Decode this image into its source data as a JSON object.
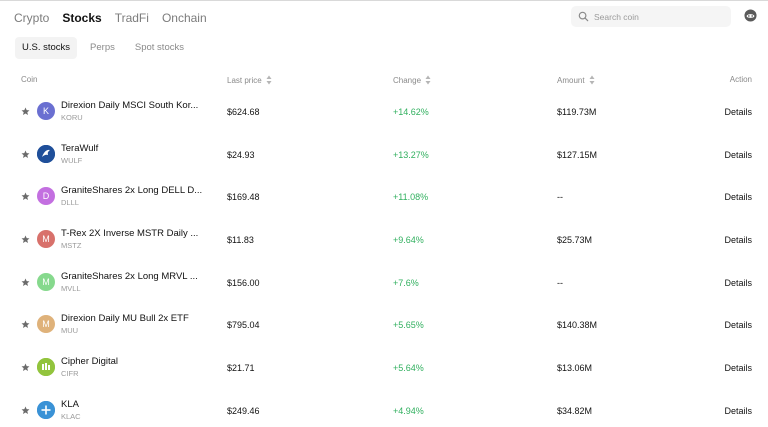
{
  "tabs": [
    {
      "label": "Crypto",
      "active": false
    },
    {
      "label": "Stocks",
      "active": true
    },
    {
      "label": "TradFi",
      "active": false
    },
    {
      "label": "Onchain",
      "active": false
    }
  ],
  "search": {
    "placeholder": "Search coin",
    "icon": "search-icon"
  },
  "profile": {
    "icon": "user-avatar-icon"
  },
  "subtabs": [
    {
      "label": "U.S. stocks",
      "active": true
    },
    {
      "label": "Perps",
      "active": false
    },
    {
      "label": "Spot stocks",
      "active": false
    }
  ],
  "table": {
    "headers": {
      "coin": "Coin",
      "last_price": "Last price",
      "change": "Change",
      "amount": "Amount",
      "action": "Action"
    },
    "rows": [
      {
        "name": "Direxion Daily MSCI South Kor...",
        "ticker": "KORU",
        "avatar_letter": "K",
        "avatar_color": "#6a6fd1",
        "price": "$624.68",
        "change": "+14.62%",
        "amount": "$119.73M",
        "action": "Details"
      },
      {
        "name": "TeraWulf",
        "ticker": "WULF",
        "avatar_letter": "",
        "avatar_color": "#1f4f9a",
        "price": "$24.93",
        "change": "+13.27%",
        "amount": "$127.15M",
        "action": "Details"
      },
      {
        "name": "GraniteShares 2x Long DELL D...",
        "ticker": "DLLL",
        "avatar_letter": "D",
        "avatar_color": "#c36fe0",
        "price": "$169.48",
        "change": "+11.08%",
        "amount": "--",
        "action": "Details"
      },
      {
        "name": "T-Rex 2X Inverse MSTR Daily ...",
        "ticker": "MSTZ",
        "avatar_letter": "M",
        "avatar_color": "#d8716b",
        "price": "$11.83",
        "change": "+9.64%",
        "amount": "$25.73M",
        "action": "Details"
      },
      {
        "name": "GraniteShares 2x Long MRVL ...",
        "ticker": "MVLL",
        "avatar_letter": "M",
        "avatar_color": "#86d98d",
        "price": "$156.00",
        "change": "+7.6%",
        "amount": "--",
        "action": "Details"
      },
      {
        "name": "Direxion Daily MU Bull 2x ETF",
        "ticker": "MUU",
        "avatar_letter": "M",
        "avatar_color": "#dfb27a",
        "price": "$795.04",
        "change": "+5.65%",
        "amount": "$140.38M",
        "action": "Details"
      },
      {
        "name": "Cipher Digital",
        "ticker": "CIFR",
        "avatar_letter": "",
        "avatar_color": "#92c43d",
        "price": "$21.71",
        "change": "+5.64%",
        "amount": "$13.06M",
        "action": "Details"
      },
      {
        "name": "KLA",
        "ticker": "KLAC",
        "avatar_letter": "",
        "avatar_color": "#3a92d6",
        "price": "$249.46",
        "change": "+4.94%",
        "amount": "$34.82M",
        "action": "Details"
      }
    ]
  }
}
